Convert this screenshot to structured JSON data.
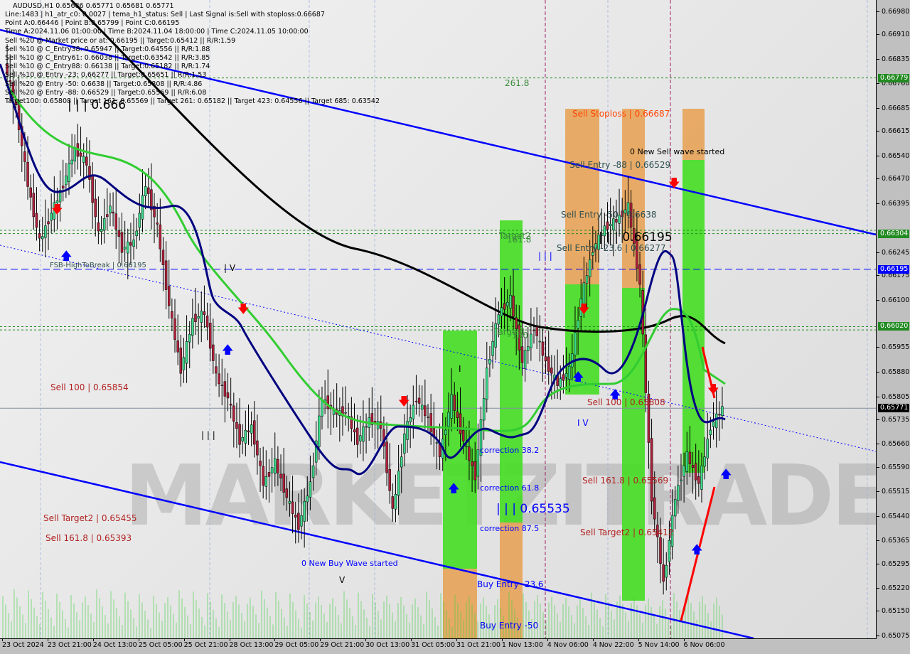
{
  "header": {
    "symbol_line": "AUDUSD,H1  0.65686 0.65771 0.65681 0.65771",
    "info_lines": [
      "Line:1483 | h1_atr_c0: 0.0027 | tema_h1_status: Sell | Last Signal is:Sell with stoploss:0.66687",
      "Point A:0.66446 | Point B:0.65799 | Point C:0.66195",
      "Time A:2024.11.06 01:00:00 | Time B:2024.11.04 18:00:00 | Time C:2024.11.05 10:00:00",
      "Sell %20 @ Market price or at: 0.66195 || Target:0.65412 || R/R:1.59",
      "Sell %10 @ C_Entry38: 0.65947 || Target:0.64556 || R/R:1.88",
      "Sell %10 @ C_Entry61: 0.66038 || Target:0.63542 || R/R:3.85",
      "Sell %10 @ C_Entry88: 0.66138 || Target:0.65182 || R/R:1.74",
      "Sell %10 @ Entry -23: 0.66277 || Target:0.65651 || R/R:1.53",
      "Sell %20 @ Entry -50: 0.6638 || Target:0.65808 || R/R:4.86",
      "Sell %20 @ Entry -88: 0.66529 || Target:0.65569 || R/R:6.08",
      "Target100: 0.65808 || Target 161: 0.65569 || Target 261: 0.65182 || Target 423: 0.64556 || Target 685: 0.63542"
    ]
  },
  "annotations": {
    "fib_261": "261.8",
    "wave_top_left": "| | | 0.666",
    "sell_stoploss": "Sell Stoploss | 0.66687",
    "new_sell_wave": "0 New Sell wave started",
    "sell_entry_88": "Sell Entry -88 | 0.66529",
    "sell_entry_50": "Sell Entry -50 | 0.6638",
    "wave_iii_right": "| | | 0.66195",
    "sell_entry_236": "Sell Entry -23.6 | 0.66277",
    "target2": "Target2",
    "target2_val": "161.8",
    "wave_iii_mid": "| | |",
    "target1": "Target1",
    "target1_val": "100",
    "fsb": "FSB-HighToBreak | 0.66195",
    "wave_iv_left": "| V",
    "sell_100_left": "Sell 100 | 0.65854",
    "wave_iii_left": "| | |",
    "sell_100_right": "Sell 100 | 0.65808",
    "wave_iv_right": "I V",
    "correction_382": "correction 38.2",
    "sell_1618_right": "Sell 161.8 | 0.65569",
    "correction_618": "correction 61.8",
    "wave_iii_low": "| | | 0.65535",
    "sell_target2_left": "Sell Target2 | 0.65455",
    "sell_1618_left": "Sell 161.8 | 0.65393",
    "correction_875": "correction 87.5",
    "sell_target2_right": "Sell Target2 | 0.65412",
    "new_buy_wave": "0 New Buy Wave started",
    "buy_entry_236": "Buy Entry -23.6",
    "buy_entry_50": "Buy Entry -50",
    "wave_v": "V",
    "wave_i": "I",
    "watermark": "MARKETZITRADE"
  },
  "chart_data": {
    "type": "candlestick",
    "symbol": "AUDUSD",
    "timeframe": "H1",
    "ylim": [
      0.65075,
      0.6698
    ],
    "y_ticks": [
      "0.66980",
      "0.66910",
      "0.66835",
      "0.66760",
      "0.66685",
      "0.66615",
      "0.66540",
      "0.66470",
      "0.66395",
      "0.66245",
      "0.66175",
      "0.66100",
      "0.65955",
      "0.65880",
      "0.65805",
      "0.65735",
      "0.65660",
      "0.65590",
      "0.65515",
      "0.65440",
      "0.65365",
      "0.65295",
      "0.65220",
      "0.65150",
      "0.65075"
    ],
    "x_ticks": [
      "23 Oct 2024",
      "23 Oct 21:00",
      "24 Oct 13:00",
      "25 Oct 05:00",
      "25 Oct 21:00",
      "28 Oct 13:00",
      "29 Oct 05:00",
      "29 Oct 21:00",
      "30 Oct 13:00",
      "31 Oct 05:00",
      "31 Oct 21:00",
      "1 Nov 13:00",
      "4 Nov 06:00",
      "4 Nov 22:00",
      "5 Nov 14:00",
      "6 Nov 06:00"
    ],
    "price_levels": [
      {
        "value": 0.66779,
        "label": "0.66779",
        "color": "#228b22",
        "style": "dashed"
      },
      {
        "value": 0.66314,
        "label": "0.66314",
        "color": "#228b22",
        "style": "dashed"
      },
      {
        "value": 0.66304,
        "label": "0.66304",
        "color": "#228b22",
        "style": "dashed"
      },
      {
        "value": 0.66195,
        "label": "0.66195",
        "color": "#0000ff",
        "style": "longdash"
      },
      {
        "value": 0.6602,
        "label": "0.66020",
        "color": "#228b22",
        "style": "dashed"
      },
      {
        "value": 0.6601,
        "label": "0.66010",
        "color": "#228b22",
        "style": "dashed"
      },
      {
        "value": 0.65771,
        "label": "0.65771",
        "color": "#000000",
        "style": "solid"
      }
    ],
    "approx_closes": [
      0.66822,
      0.66691,
      0.66453,
      0.66279,
      0.66366,
      0.66453,
      0.66561,
      0.66518,
      0.66301,
      0.66388,
      0.66257,
      0.66279,
      0.66453,
      0.66322,
      0.66084,
      0.65888,
      0.6604,
      0.66062,
      0.65867,
      0.65802,
      0.65671,
      0.65715,
      0.65541,
      0.65606,
      0.65498,
      0.65411,
      0.65541,
      0.65802,
      0.65758,
      0.65758,
      0.65671,
      0.65737,
      0.65715,
      0.65454,
      0.65693,
      0.65802,
      0.65737,
      0.65628,
      0.65802,
      0.65671,
      0.65563,
      0.65888,
      0.66062,
      0.66105,
      0.6591,
      0.66019,
      0.6591,
      0.65845,
      0.65888,
      0.66105,
      0.66257,
      0.66322,
      0.66344,
      0.66388,
      0.66149,
      0.65498,
      0.65237,
      0.65498,
      0.65628,
      0.65541,
      0.65715,
      0.65771
    ],
    "colors": {
      "bull": "#3cd98a",
      "bear": "#b0203a",
      "ma_fast": "#000080",
      "ma_mid": "#32cd32",
      "ma_slow": "#000000",
      "channel": "#0000ff",
      "zone_buy": "#44dd22",
      "zone_sell": "#e8a050"
    }
  }
}
